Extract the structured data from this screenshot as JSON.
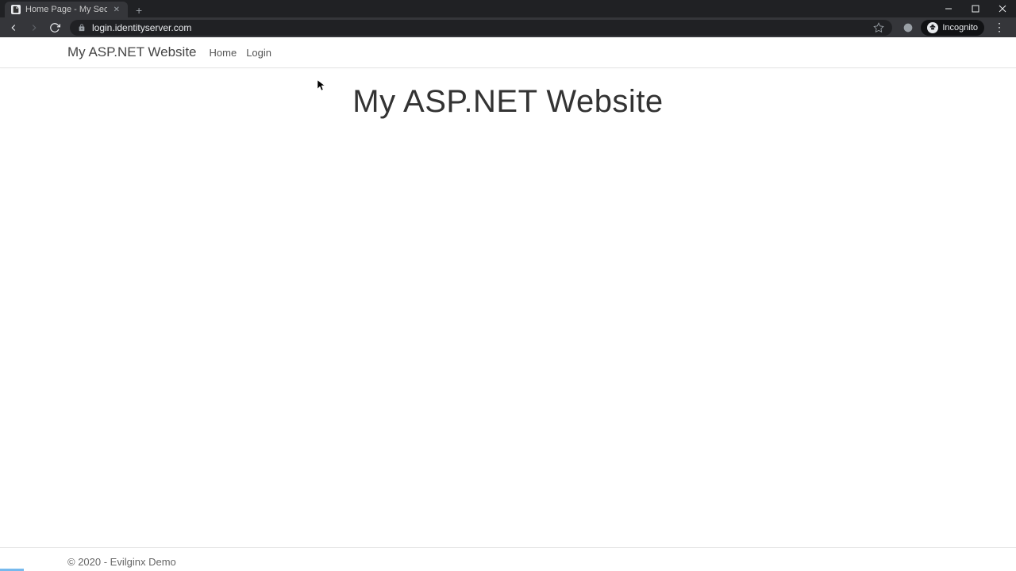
{
  "browser": {
    "tab_title": "Home Page - My Secure ASP.NET",
    "url": "login.identityserver.com",
    "incognito_label": "Incognito"
  },
  "navbar": {
    "brand": "My ASP.NET Website",
    "links": {
      "home": "Home",
      "login": "Login"
    }
  },
  "page": {
    "heading": "My ASP.NET Website"
  },
  "footer": {
    "text": "© 2020 - Evilginx Demo"
  }
}
